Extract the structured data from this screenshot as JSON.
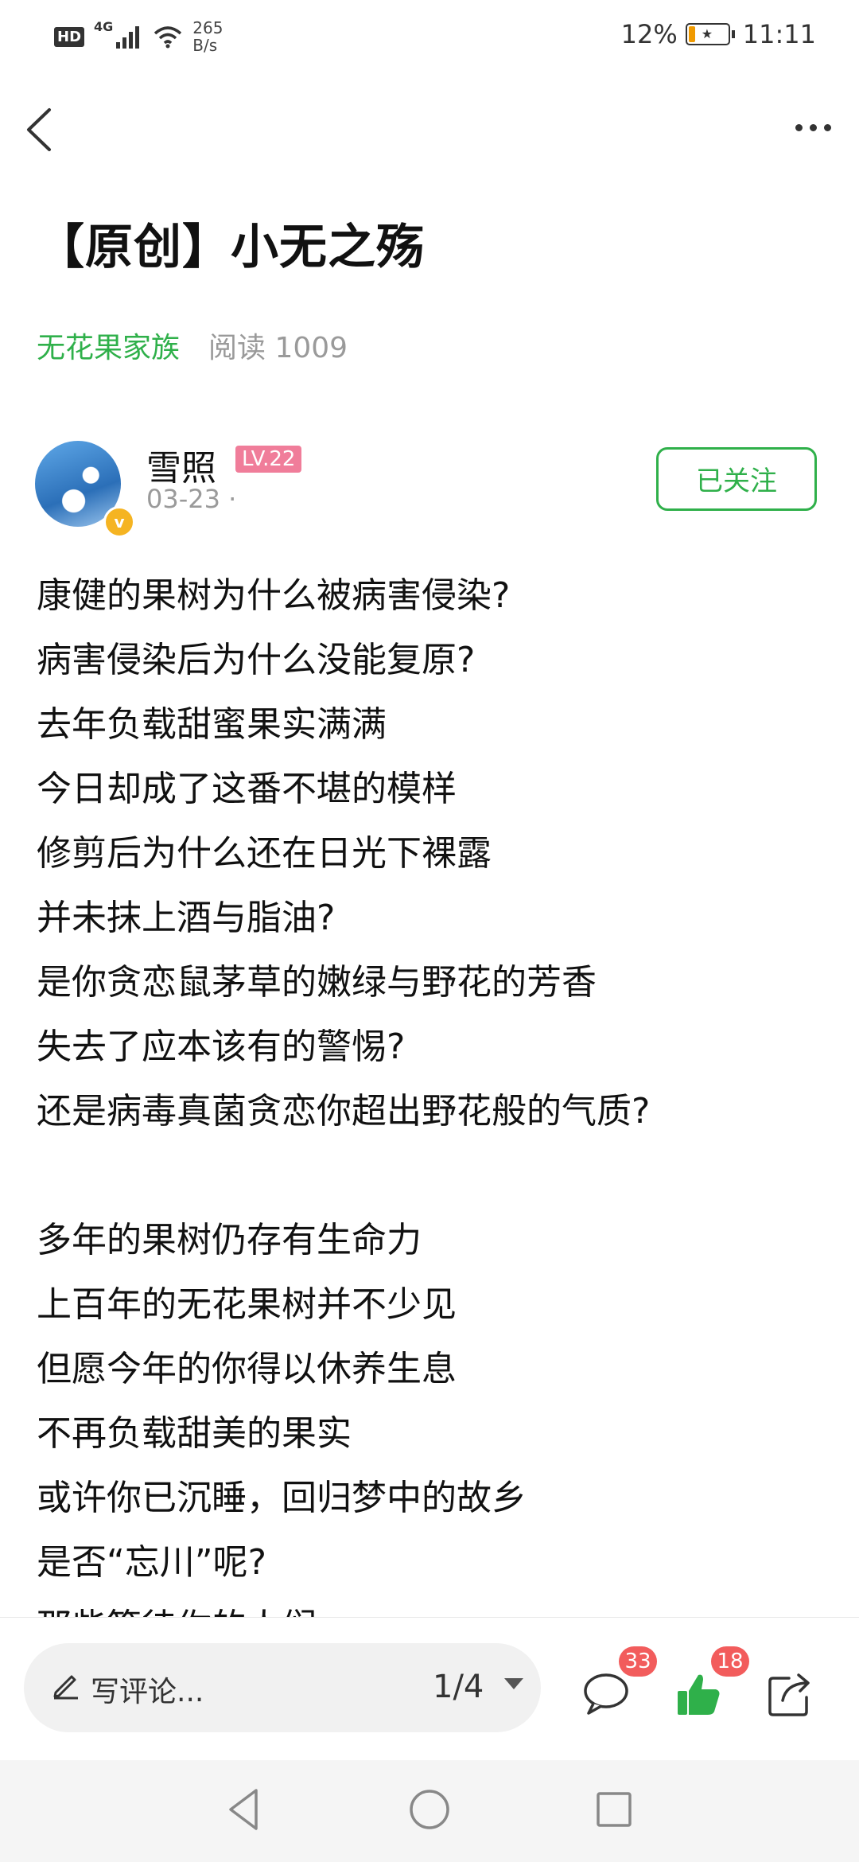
{
  "status_bar": {
    "hd": "HD",
    "network": "4G",
    "speed_value": "265",
    "speed_unit": "B/s",
    "battery": "12%",
    "time": "11:11"
  },
  "nav": {
    "back_icon": "chevron-left-icon",
    "more_icon": "more-horizontal-icon"
  },
  "article": {
    "title": "【原创】小无之殇",
    "circle": "无花果家族",
    "read_label": "阅读 1009"
  },
  "author": {
    "name": "雪照",
    "level": "LV.22",
    "date": "03-23 ·",
    "verified_icon": "verified-v-icon",
    "follow_label": "已关注"
  },
  "body_lines": [
    "康健的果树为什么被病害侵染?",
    "病害侵染后为什么没能复原?",
    "去年负载甜蜜果实满满",
    "今日却成了这番不堪的模样",
    "修剪后为什么还在日光下裸露",
    "并未抹上酒与脂油?",
    "是你贪恋鼠茅草的嫩绿与野花的芳香",
    "失去了应本该有的警惕?",
    "还是病毒真菌贪恋你超出野花般的气质?",
    "",
    "多年的果树仍存有生命力",
    "上百年的无花果树并不少见",
    "但愿今年的你得以休养生息",
    "不再负载甜美的果实",
    "或许你已沉睡，回归梦中的故乡",
    "是否“忘川”呢?",
    "那些等待你的人们"
  ],
  "bottom_bar": {
    "comment_placeholder": "写评论...",
    "page_indicator": "1/4",
    "comment_count": "33",
    "like_count": "18",
    "colors": {
      "accent_green": "#2fb04a",
      "badge_red": "#f25c5c"
    }
  }
}
